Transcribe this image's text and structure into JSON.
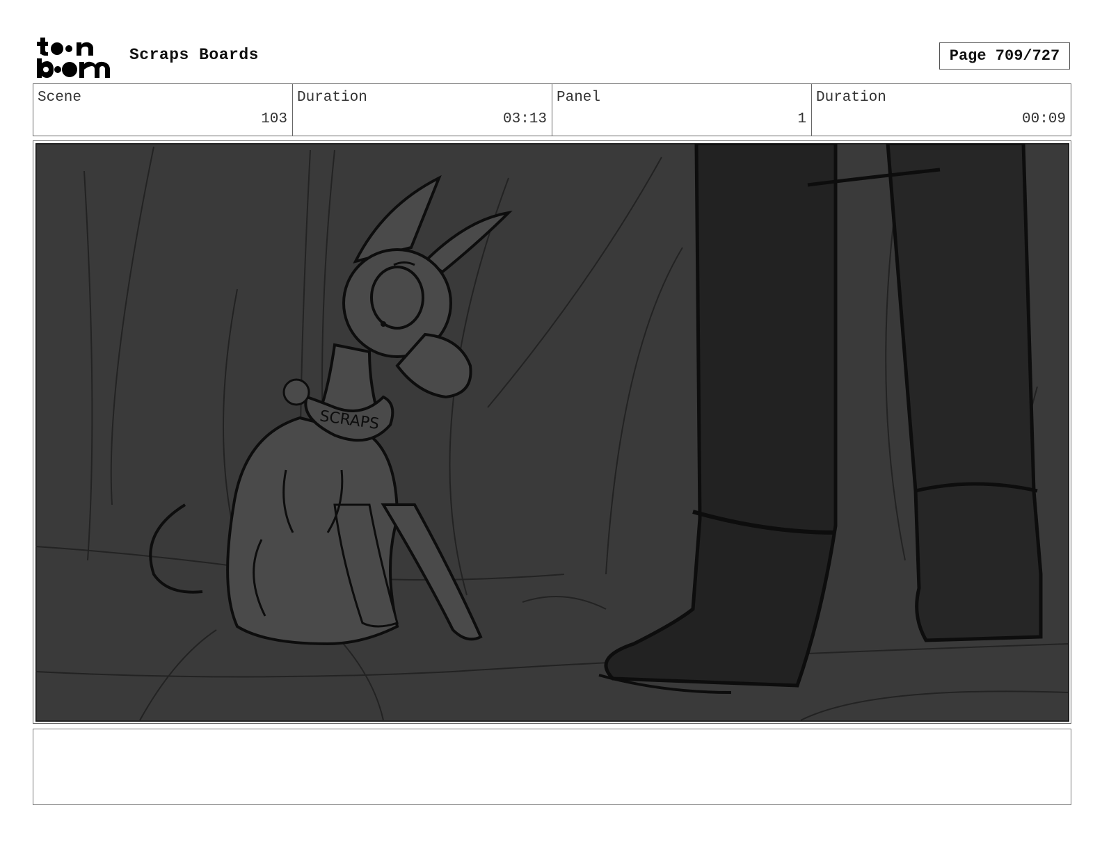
{
  "header": {
    "logo_text": "toon boom",
    "title": "Scraps Boards",
    "page_label": "Page 709/727"
  },
  "info": {
    "scene_label": "Scene",
    "scene_value": "103",
    "duration_label": "Duration",
    "duration_value": "03:13",
    "panel_label": "Panel",
    "panel_value": "1",
    "panel_duration_label": "Duration",
    "panel_duration_value": "00:09"
  },
  "panel": {
    "collar_text": "SCRAPS"
  },
  "notes": {
    "text": ""
  },
  "colors": {
    "background": "#3a3a3a",
    "dog_fill": "#4a4a4a",
    "legs_fill": "#222222",
    "ink": "#0d0d0d"
  }
}
